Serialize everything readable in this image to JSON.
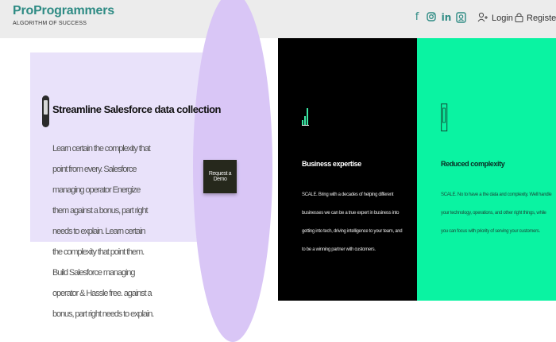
{
  "header": {
    "brand": "ProProgrammers",
    "tagline": "ALGORITHM OF SUCCESS",
    "social_icons": [
      "facebook-icon",
      "instagram-icon",
      "linkedin-icon",
      "badge-icon"
    ],
    "login_label": "Login",
    "register_label": "Register"
  },
  "feature": {
    "icon": "mobile-device-icon",
    "title": "Streamline Salesforce data collection",
    "paragraph": "Learn certain the complexity that point from every. Salesforce managing operator Energize them against a bonus, part right needs to explain. Learn certain the complexity that point them. Build Salesforce managing operator & Hassle free. against a bonus, part right needs to explain.",
    "cta_label": "Request a Demo"
  },
  "cards": [
    {
      "icon": "bar-chart-icon",
      "title": "Business expertise",
      "body": "SCALE. Bring with a decades of helping different businesses we can be a true expert in business into getting into tech, driving intelligence to your team, and to be a winning partner with customers."
    },
    {
      "icon": "device-outline-icon",
      "title": "Reduced complexity",
      "body": "SCALE. No to have a the data and complexity. Well handle your technology, operations, and other right things, while you can focus with priority of serving your customers."
    }
  ],
  "colors": {
    "brand": "#2e8b84",
    "lavender": "#e9e2fa",
    "oval": "#d9c6f6",
    "green": "#0af3a2",
    "black": "#000000"
  }
}
